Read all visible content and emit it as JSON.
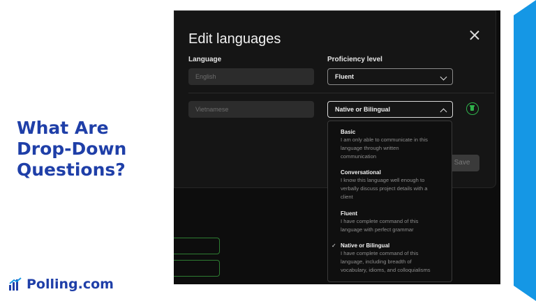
{
  "headline": [
    "What Are",
    "Drop-Down",
    "Questions?"
  ],
  "brand": {
    "name": "Polling.com"
  },
  "dialog": {
    "title": "Edit languages",
    "language_label": "Language",
    "proficiency_label": "Proficiency level",
    "rows": [
      {
        "language": "English",
        "proficiency": "Fluent",
        "open": false
      },
      {
        "language": "Vietnamese",
        "proficiency": "Native or Bilingual",
        "open": true
      }
    ],
    "save_label": "Save"
  },
  "dropdown": {
    "options": [
      {
        "title": "Basic",
        "desc": [
          "I am only able to communicate in this",
          "language through written",
          "communication"
        ],
        "selected": false
      },
      {
        "title": "Conversational",
        "desc": [
          "I know this language well enough to",
          "verbally discuss project details with a",
          "client"
        ],
        "selected": false
      },
      {
        "title": "Fluent",
        "desc": [
          "I have complete command of this",
          "language with perfect grammar"
        ],
        "selected": false
      },
      {
        "title": "Native or Bilingual",
        "desc": [
          "I have complete command of this",
          "language, including breadth of",
          "vocabulary, idioms, and colloquialisms"
        ],
        "selected": true
      }
    ],
    "check_glyph": "✓"
  },
  "colors": {
    "brand_blue": "#1f3fa8",
    "accent": "#1597e5",
    "success_green": "#2fb24b"
  }
}
